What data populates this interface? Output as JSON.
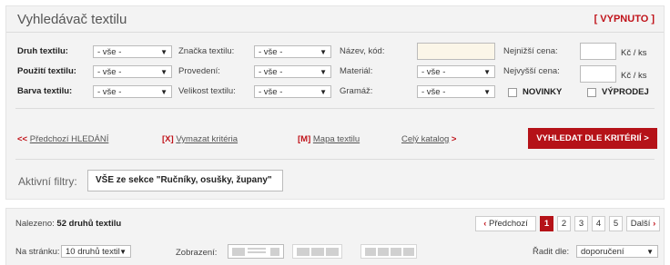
{
  "title": "Vyhledávač textilu",
  "toggle_label": "[ VYPNUTO ]",
  "form": {
    "druh_label": "Druh textilu:",
    "druh_value": "- vše -",
    "pouziti_label": "Použití textilu:",
    "pouziti_value": "- vše -",
    "barva_label": "Barva textilu:",
    "barva_value": "- vše -",
    "znacka_label": "Značka textilu:",
    "znacka_value": "- vše -",
    "provedeni_label": "Provedení:",
    "provedeni_value": "- vše -",
    "velikost_label": "Velikost textilu:",
    "velikost_value": "- vše -",
    "nazev_label": "Název, kód:",
    "nazev_value": "",
    "material_label": "Materiál:",
    "material_value": "- vše -",
    "gramaz_label": "Gramáž:",
    "gramaz_value": "- vše -",
    "min_price_label": "Nejnižší cena:",
    "max_price_label": "Nejvyšší cena:",
    "price_unit": "Kč / ks",
    "novinky_label": "NOVINKY",
    "vyprodej_label": "VÝPRODEJ"
  },
  "actions": {
    "prev_search_prefix": "<< ",
    "prev_search": "Předchozí HLEDÁNÍ",
    "clear_mark": "[X]",
    "clear_label": "Vymazat kritéria",
    "map_mark": "[M]",
    "map_label": "Mapa textilu",
    "catalog_label": "Celý katalog",
    "catalog_suffix": " >",
    "search_button": "VYHLEDAT DLE KRITÉRIÍ >"
  },
  "active_filters": {
    "label": "Aktivní filtry:",
    "value": "VŠE ze sekce \"Ručníky, osušky, župany\""
  },
  "results": {
    "found_prefix": "Nalezeno: ",
    "found_count": "52 druhů textilu",
    "per_page_label": "Na stránku:",
    "per_page_value": "10 druhů textil",
    "view_label": "Zobrazení:",
    "sort_label": "Řadit dle:",
    "sort_value": "doporučení"
  },
  "pagination": {
    "prev": "Předchozí",
    "pages": [
      "1",
      "2",
      "3",
      "4",
      "5"
    ],
    "current": "1",
    "next": "Další"
  },
  "colors": {
    "accent": "#b51218",
    "panel_bg": "#f3f3f3"
  }
}
